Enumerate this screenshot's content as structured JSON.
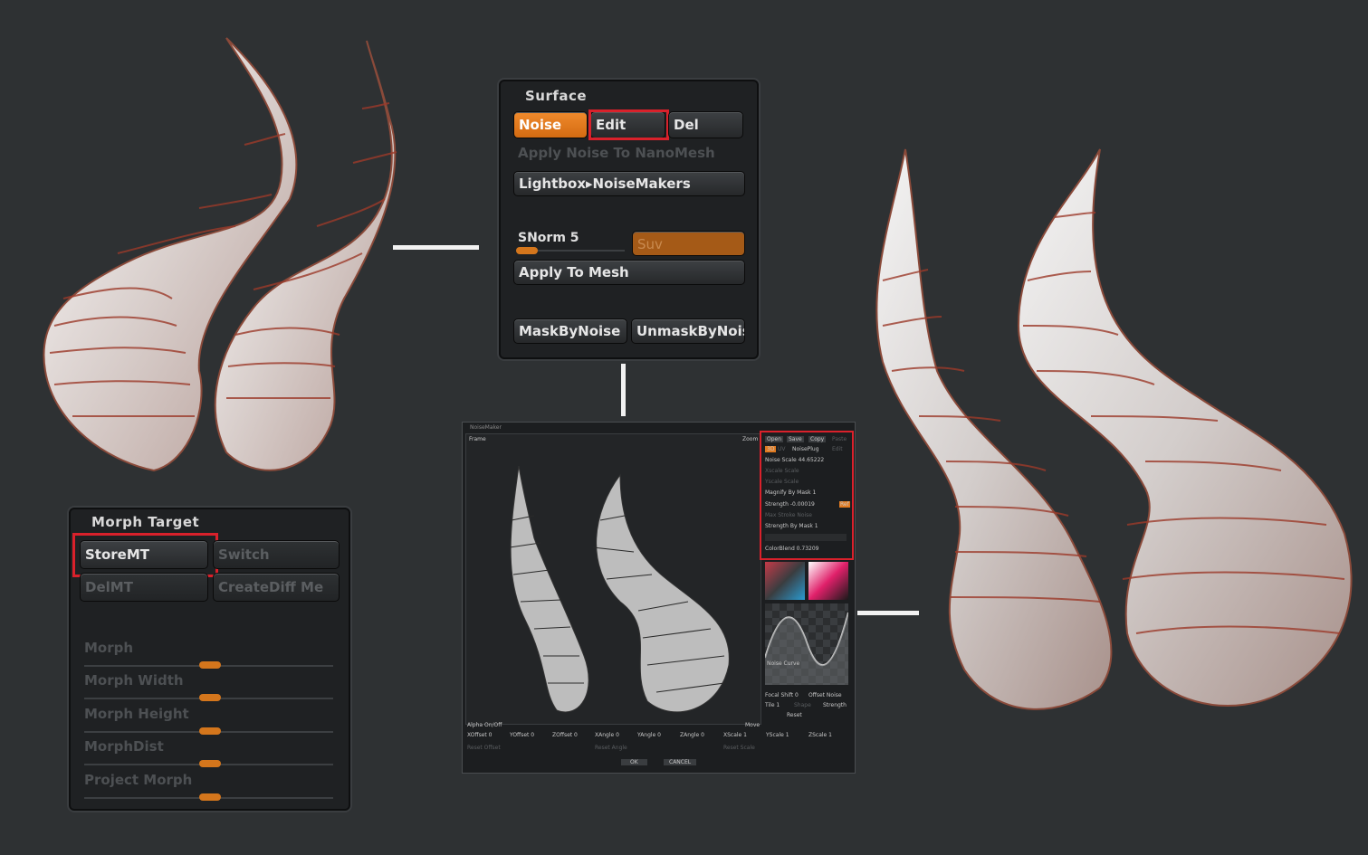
{
  "surface": {
    "title": "Surface",
    "noise_button": "Noise",
    "edit_button": "Edit",
    "del_button": "Del",
    "apply_nanomesh": "Apply Noise To NanoMesh",
    "lightbox_button": "Lightbox▸NoiseMakers",
    "snorm_label": "SNorm 5",
    "suv_button": "Suv",
    "apply_mesh_button": "Apply To Mesh",
    "maskbynoise_button": "MaskByNoise",
    "unmaskbynoise_button": "UnmaskByNois"
  },
  "morph": {
    "title": "Morph Target",
    "storemt_button": "StoreMT",
    "switch_button": "Switch",
    "delmt_button": "DelMT",
    "creatediff_button": "CreateDiff Me",
    "sliders": [
      {
        "label": "Morph",
        "value": 0.5
      },
      {
        "label": "Morph Width",
        "value": 0.5
      },
      {
        "label": "Morph Height",
        "value": 0.5
      },
      {
        "label": "MorphDist",
        "value": 0.5
      },
      {
        "label": "Project Morph",
        "value": 0.5
      }
    ]
  },
  "noisemaker": {
    "window_title": "NoiseMaker",
    "frame_label": "Frame",
    "zoom_label": "Zoom",
    "open_button": "Open",
    "save_button": "Save",
    "copy_button": "Copy",
    "paste_button": "Paste",
    "tab_3d": "3D",
    "tab_uv": "UV",
    "noiseplug_button": "NoisePlug",
    "edit_button": "Edit",
    "noise_scale": "Noise Scale 44.65222",
    "xscale_label": "Xscale Scale",
    "yscale_label": "Yscale Scale",
    "magnify_by_mask": "Magnify By Mask 1",
    "strength": "Strength -0.00019",
    "ref_button": "Ref",
    "max_stroke_noise": "Max Stroke Noise",
    "strength_by_mask": "Strength By Mask 1",
    "colorblend": "ColorBlend 0.73209",
    "noise_curve": "Noise Curve",
    "focal_shift": "Focal Shift 0",
    "offset_noise": "Offset Noise",
    "tile": "Tile 1",
    "shape": "Shape",
    "strength2": "Strength",
    "reset": "Reset",
    "alpha_onoff": "Alpha On/Off",
    "move": "Move",
    "xoffset": "XOffset 0",
    "yoffset": "YOffset 0",
    "zoffset": "ZOffset 0",
    "xangle": "XAngle 0",
    "yangle": "YAngle 0",
    "zangle": "ZAngle 0",
    "xscale": "XScale 1",
    "yscale": "YScale 1",
    "zscale": "ZScale 1",
    "reset_offset": "Reset Offset",
    "reset_angle": "Reset Angle",
    "reset_scale": "Reset Scale",
    "ok_button": "OK",
    "cancel_button": "CANCEL"
  },
  "colors": {
    "accent": "#e07a20",
    "highlight": "#d9212b",
    "panel": "#1f2123",
    "background": "#2e3133"
  }
}
